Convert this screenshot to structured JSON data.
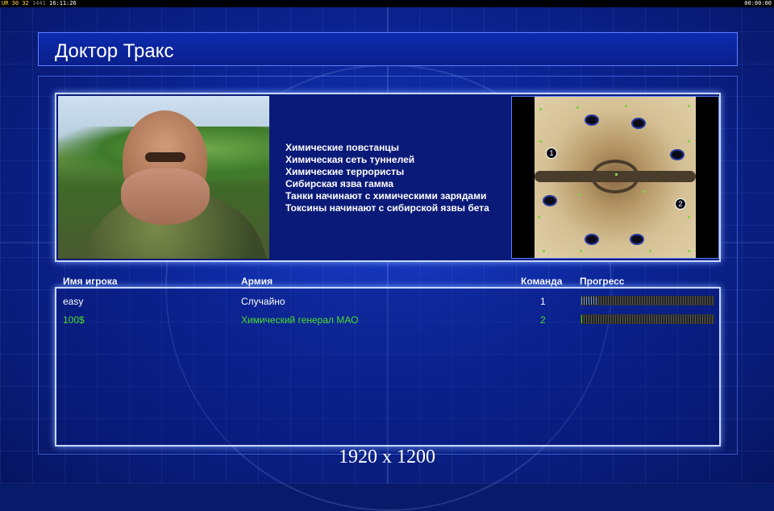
{
  "status_bar": {
    "left_label": "UR",
    "fps_a": "30",
    "fps_b": "32",
    "frame": "1441",
    "clock": "16:11:26",
    "right_clock": "00:00:00"
  },
  "title": "Доктор Тракс",
  "description_lines": [
    "Химические повстанцы",
    "Химическая сеть туннелей",
    "Химические террористы",
    "Сибирская язва гамма",
    "Танки начинают с химическими зарядами",
    "Токсины начинают с сибирской язвы бета"
  ],
  "minimap": {
    "start_positions": [
      "1",
      "2"
    ]
  },
  "table": {
    "headers": {
      "player": "Имя игрока",
      "army": "Армия",
      "team": "Команда",
      "progress": "Прогресс"
    },
    "rows": [
      {
        "player": "easy",
        "army": "Случайно",
        "team": "1",
        "progress": 0.12,
        "color": "#ffffff"
      },
      {
        "player": "100$",
        "army": "Химический генерал МАО",
        "team": "2",
        "progress": 0.02,
        "color": "#4adf2a"
      }
    ]
  },
  "resolution_label": "1920 x 1200",
  "colors": {
    "accent_frame": "#c8d8ff",
    "player1": "#ffffff",
    "player2": "#4adf2a",
    "progress_fill_1": "#6fa0ff",
    "progress_fill_2": "#4adf2a"
  }
}
